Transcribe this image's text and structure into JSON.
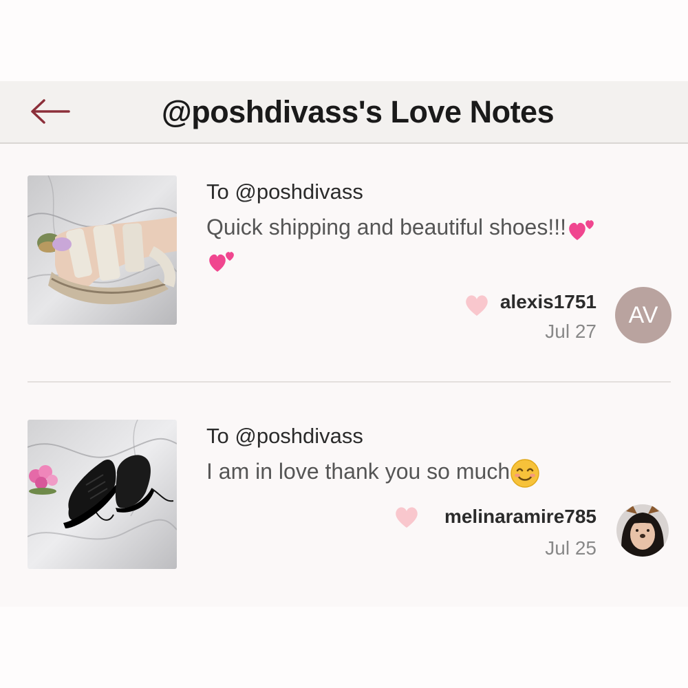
{
  "header": {
    "title": "@poshdivass's Love Notes",
    "back_icon": "arrow-left-icon",
    "accent": "#8c2f3a"
  },
  "notes": [
    {
      "to": "To @poshdivass",
      "message": "Quick shipping and beautiful shoes!!!",
      "message_emoji": "sparkling-heart",
      "user": "alexis1751",
      "date": "Jul 27",
      "avatar_initials": "AV",
      "product_image": "sandals-on-marble"
    },
    {
      "to": "To @poshdivass",
      "message": "I am in love thank you so much",
      "message_emoji": "smiling-face",
      "user": "melinaramire785",
      "date": "Jul 25",
      "product_image": "black-sneakers-on-marble"
    }
  ],
  "colors": {
    "like_heart": "#f9c7cd",
    "avatar_bg": "#b9a39f",
    "emoji_heart": "#f0468f"
  }
}
